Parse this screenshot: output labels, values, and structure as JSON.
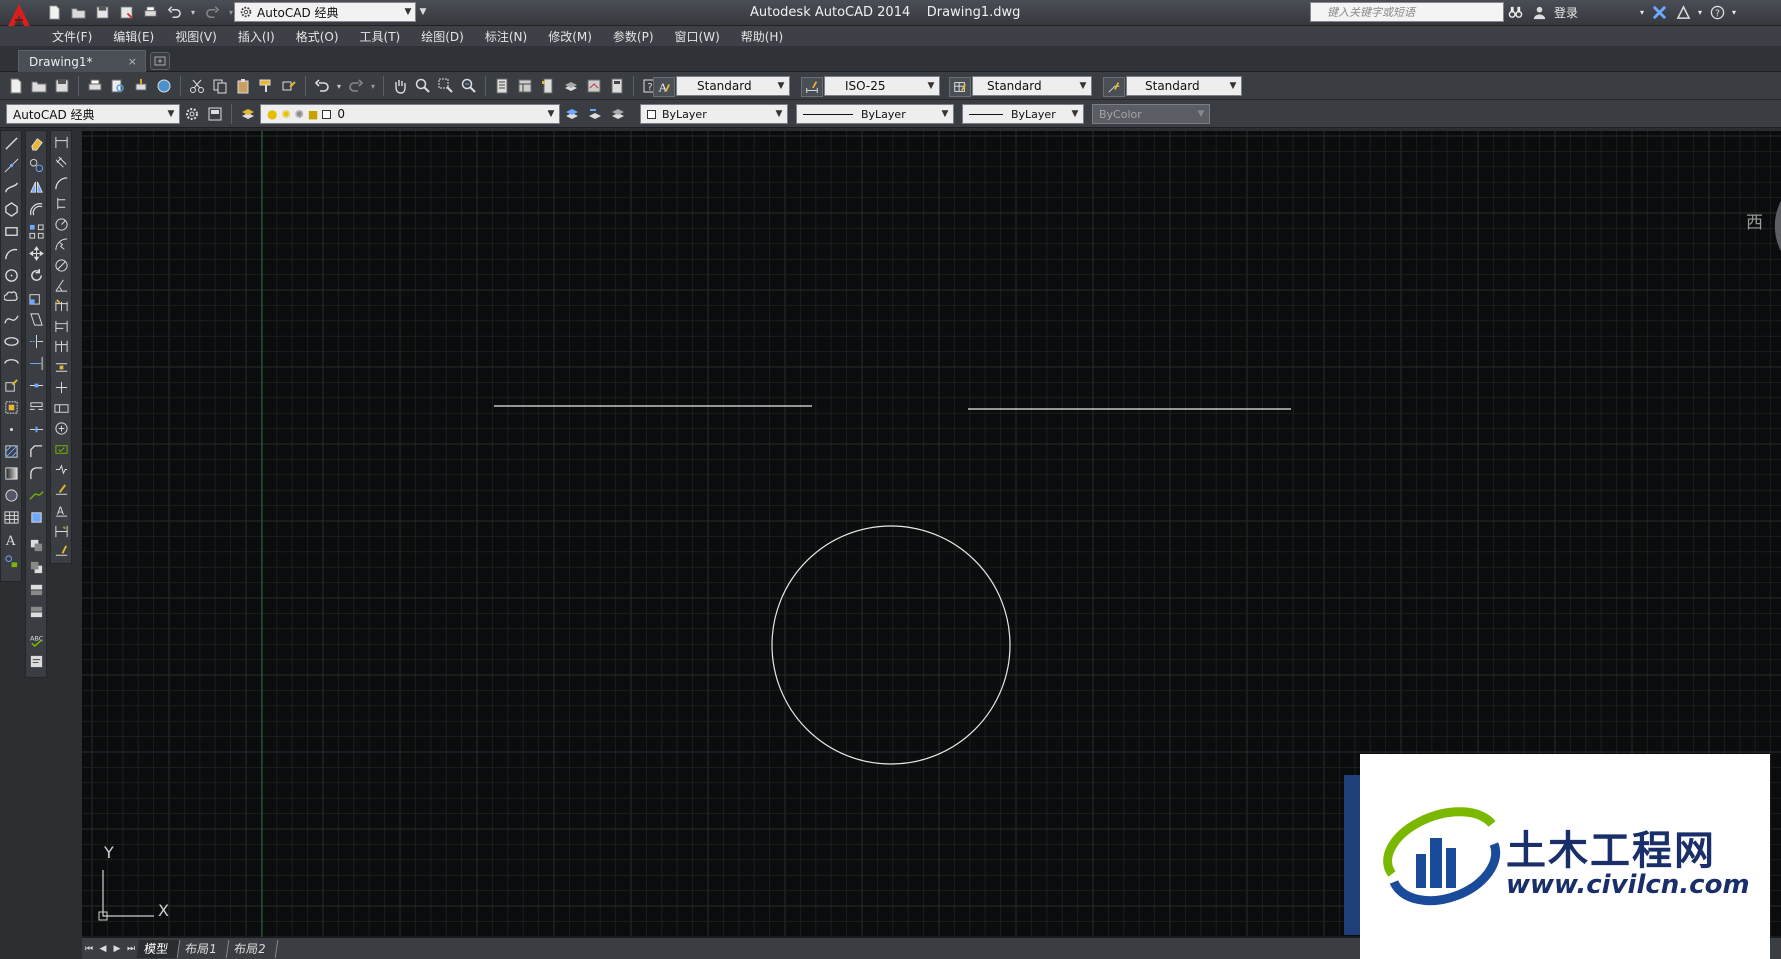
{
  "titlebar": {
    "app_title": "Autodesk AutoCAD 2014",
    "doc_title": "Drawing1.dwg",
    "workspace": "AutoCAD 经典",
    "search_placeholder": "键入关键字或短语",
    "login": "登录"
  },
  "menu": [
    "文件(F)",
    "编辑(E)",
    "视图(V)",
    "插入(I)",
    "格式(O)",
    "工具(T)",
    "绘图(D)",
    "标注(N)",
    "修改(M)",
    "参数(P)",
    "窗口(W)",
    "帮助(H)"
  ],
  "file_tab": {
    "label": "Drawing1*",
    "close": "×"
  },
  "styles_toolbar": {
    "text_style": "Standard",
    "dim_style": "ISO-25",
    "table_style": "Standard",
    "multileader_style": "Standard"
  },
  "workspace_toolbar": {
    "workspace": "AutoCAD 经典"
  },
  "layers_toolbar": {
    "current_layer": "0"
  },
  "properties_toolbar": {
    "color": "ByLayer",
    "linetype": "ByLayer",
    "lineweight": "ByLayer",
    "plotstyle": "ByColor"
  },
  "ucs": {
    "x_label": "X",
    "y_label": "Y"
  },
  "viewcube": {
    "label": "西"
  },
  "layout_tabs": [
    "模型",
    "布局1",
    "布局2"
  ],
  "watermark": {
    "brand": "土木工程网",
    "url": "www.civilcn.com"
  },
  "colors": {
    "canvas": "#0b0c0d",
    "grid_minor": "#1b1f1d",
    "grid_major": "#262b28",
    "geometry": "#e8e8e8",
    "brand_blue": "#1a4a9a",
    "brand_green": "#7ab800"
  }
}
